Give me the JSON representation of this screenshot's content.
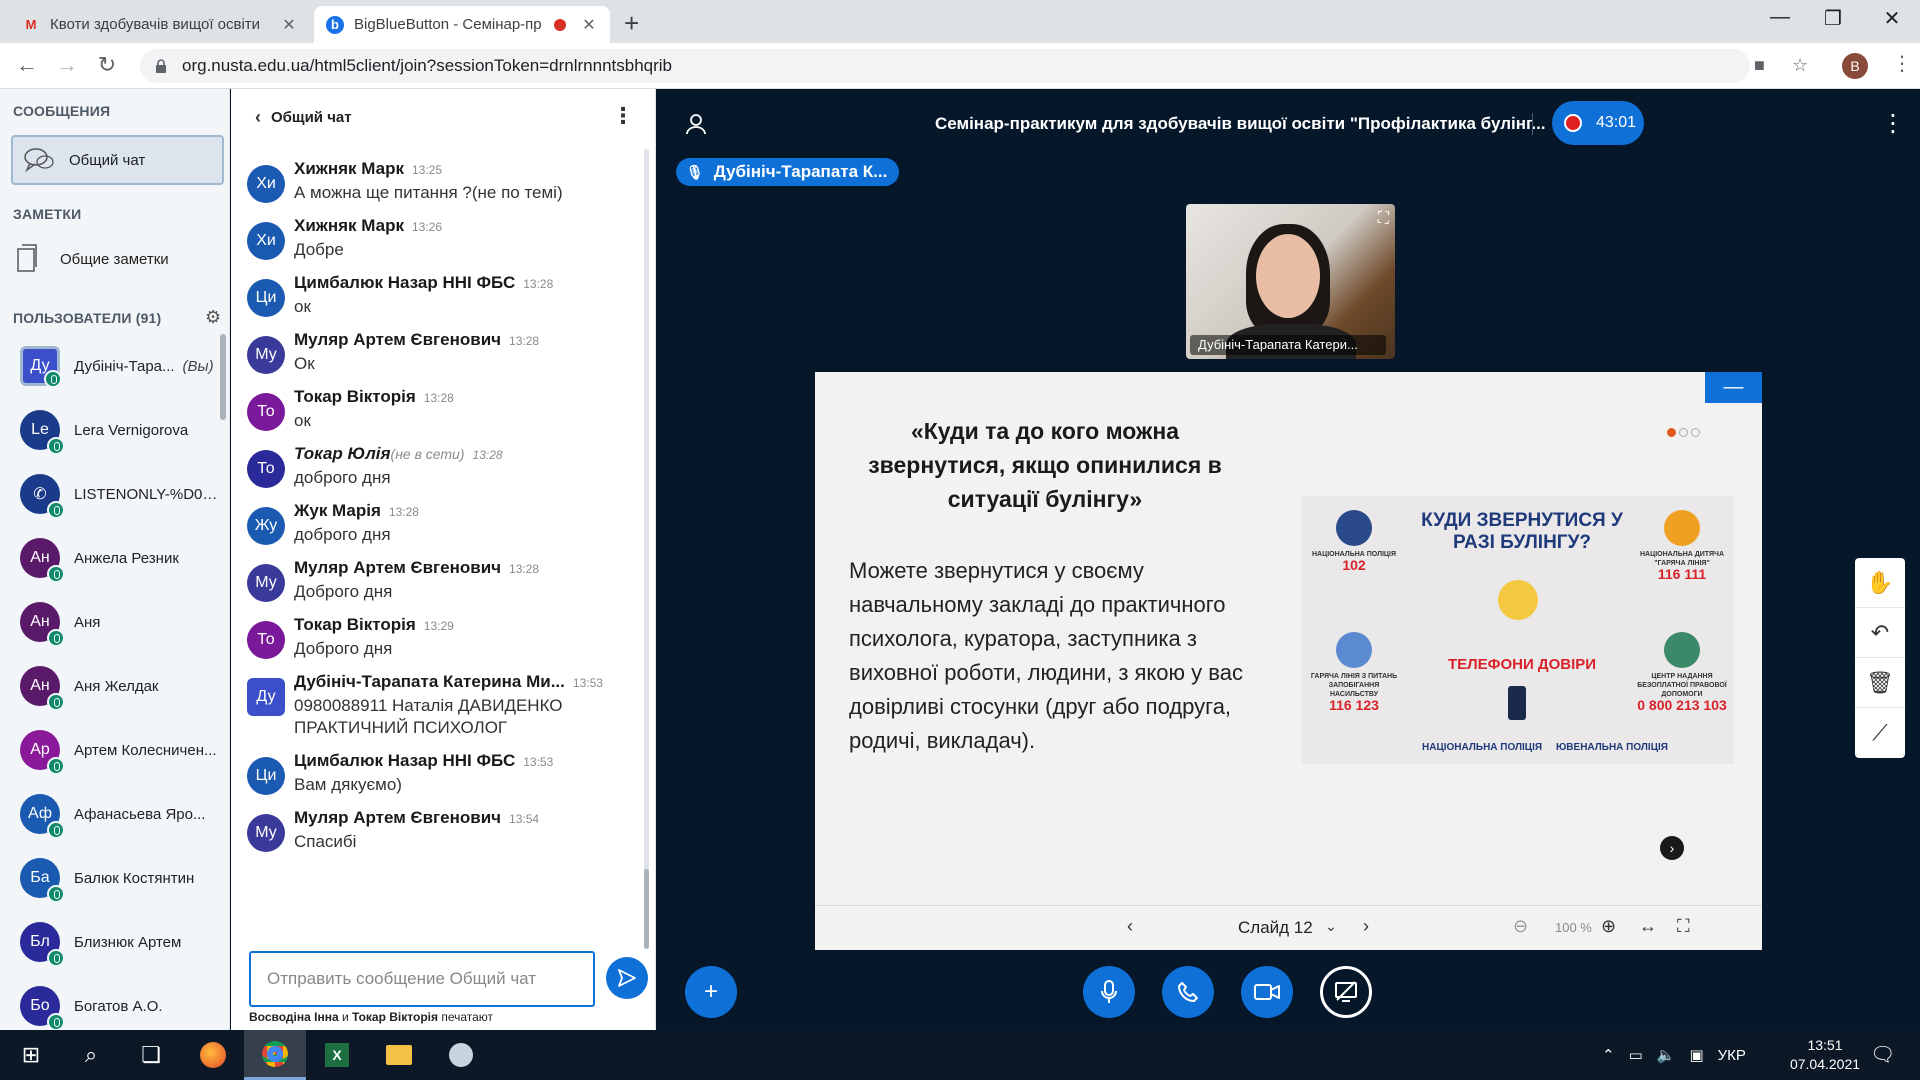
{
  "browser": {
    "tabs": [
      {
        "title": "Квоти здобувачів вищої освіти",
        "favicon": "gmail-icon",
        "favicon_color": "#d93025"
      },
      {
        "title": "BigBlueButton - Семінар-пр",
        "favicon": "bbb-icon",
        "favicon_color": "#1a73e8",
        "recording_dot": "#d93025"
      }
    ],
    "url": "org.nusta.edu.ua/html5client/join?sessionToken=drnlrnnntsbhqrib",
    "profile_initial": "B"
  },
  "sidebar": {
    "messages_header": "СООБЩЕНИЯ",
    "public_chat_label": "Общий чат",
    "notes_header": "ЗАМЕТКИ",
    "shared_notes_label": "Общие заметки",
    "users_header": "ПОЛЬЗОВАТЕЛИ (91)",
    "users": [
      {
        "initials": "Ду",
        "name": "Дубініч-Тара...",
        "you": "(Вы)",
        "color": "#3a4fc9",
        "presenter": true
      },
      {
        "initials": "Le",
        "name": "Lera Vernigorova",
        "color": "#1a3a8a"
      },
      {
        "initials": "✆",
        "name": "LISTENONLY-%D0%...",
        "color": "#1a3a8a"
      },
      {
        "initials": "Ан",
        "name": "Анжела Резник",
        "color": "#5a1a6a"
      },
      {
        "initials": "Ан",
        "name": "Аня",
        "color": "#5a1a6a"
      },
      {
        "initials": "Ан",
        "name": "Аня Желдак",
        "color": "#5a1a6a"
      },
      {
        "initials": "Ар",
        "name": "Артем Колесничен...",
        "color": "#8a1a9a"
      },
      {
        "initials": "Аф",
        "name": "Афанасьева Яро...",
        "color": "#1a5ab0"
      },
      {
        "initials": "Ба",
        "name": "Балюк Костянтин",
        "color": "#1a5ab0"
      },
      {
        "initials": "Бл",
        "name": "Близнюк Артем",
        "color": "#2a2a9a"
      },
      {
        "initials": "Бо",
        "name": "Богатов А.О.",
        "color": "#2a2a9a"
      }
    ]
  },
  "chat": {
    "title": "Общий чат",
    "messages": [
      {
        "initials": "Хи",
        "color": "#1a5ab0",
        "name": "Хижняк Марк",
        "time": "13:25",
        "text": "А можна ще питання ?(не по темі)"
      },
      {
        "initials": "Хи",
        "color": "#1a5ab0",
        "name": "Хижняк Марк",
        "time": "13:26",
        "text": "Добре"
      },
      {
        "initials": "Ци",
        "color": "#1a5ab0",
        "name": "Цимбалюк Назар ННІ ФБС",
        "time": "13:28",
        "text": "ок"
      },
      {
        "initials": "Му",
        "color": "#3a3a9a",
        "name": "Муляр Артем Євгенович",
        "time": "13:28",
        "text": "Ок"
      },
      {
        "initials": "То",
        "color": "#7a1a9a",
        "name": "Токар Вікторія",
        "time": "13:28",
        "text": "ок"
      },
      {
        "initials": "То",
        "color": "#2a2a9a",
        "name": "Токар Юлія",
        "offline": "(не в сети)",
        "time": "13:28",
        "text": "доброго дня"
      },
      {
        "initials": "Жу",
        "color": "#1a5ab0",
        "name": "Жук Марія",
        "time": "13:28",
        "text": "доброго дня"
      },
      {
        "initials": "Му",
        "color": "#3a3a9a",
        "name": "Муляр Артем Євгенович",
        "time": "13:28",
        "text": "Доброго дня"
      },
      {
        "initials": "То",
        "color": "#7a1a9a",
        "name": "Токар Вікторія",
        "time": "13:29",
        "text": "Доброго дня"
      },
      {
        "initials": "Ду",
        "color": "#3a4fc9",
        "name": "Дубініч-Тарапата Катерина Ми...",
        "time": "13:53",
        "text": "0980088911 Наталія ДАВИДЕНКО ПРАКТИЧНИЙ ПСИХОЛОГ",
        "square": true
      },
      {
        "initials": "Ци",
        "color": "#1a5ab0",
        "name": "Цимбалюк Назар ННІ ФБС",
        "time": "13:53",
        "text": "Вам дякуємо)"
      },
      {
        "initials": "Му",
        "color": "#3a3a9a",
        "name": "Муляр Артем Євгенович",
        "time": "13:54",
        "text": "Спасибі"
      }
    ],
    "input_placeholder": "Отправить сообщение Общий чат",
    "typing_user_1": "Восводіна Інна",
    "typing_and": "и",
    "typing_user_2": "Токар Вікторія",
    "typing_suffix": "печатают"
  },
  "main": {
    "title": "Семінар-практикум для здобувачів вищої освіти \"Профілактика булінг...",
    "recording_time": "43:01",
    "talking_indicator": "Дубініч-Тарапата К...",
    "webcam_label": "Дубініч-Тарапата Катери...",
    "slide": {
      "title": "«Куди та до кого можна звернутися, якщо опинилися в ситуації булінгу»",
      "body": "Можете звернутися у своєму навчальному закладі до практичного психолога, куратора, заступника з виховної роботи, людини, з якою у вас довірливі стосунки (друг або подруга, родичі, викладач).",
      "poster": {
        "heading": "КУДИ ЗВЕРНУТИСЯ У РАЗІ БУЛІНГУ?",
        "center": "ТЕЛЕФОНИ ДОВІРИ",
        "police_label": "НАЦІОНАЛЬНА ПОЛІЦІЯ",
        "police_number": "102",
        "childline_label": "НАЦІОНАЛЬНА ДИТЯЧА \"ГАРЯЧА ЛІНІЯ\"",
        "childline_number": "116 111",
        "hotline_label": "ГАРЯЧА ЛІНІЯ З ПИТАНЬ ЗАПОБІГАННЯ НАСИЛЬСТВУ",
        "hotline_number": "116 123",
        "legal_label": "ЦЕНТР НАДАННЯ БЕЗОПЛАТНОЇ ПРАВОВОЇ ДОПОМОГИ",
        "legal_number": "0 800 213 103",
        "footer_left": "НАЦІОНАЛЬНА ПОЛІЦІЯ",
        "footer_right": "ЮВЕНАЛЬНА ПОЛІЦІЯ"
      },
      "slide_label": "Слайд 12",
      "zoom": "100 %"
    }
  },
  "taskbar": {
    "language": "УКР",
    "time": "13:51",
    "date": "07.04.2021"
  },
  "colors": {
    "primary": "#0f70d7",
    "dark_bg": "#06172a",
    "sidebar_bg": "#f3f6f9"
  }
}
